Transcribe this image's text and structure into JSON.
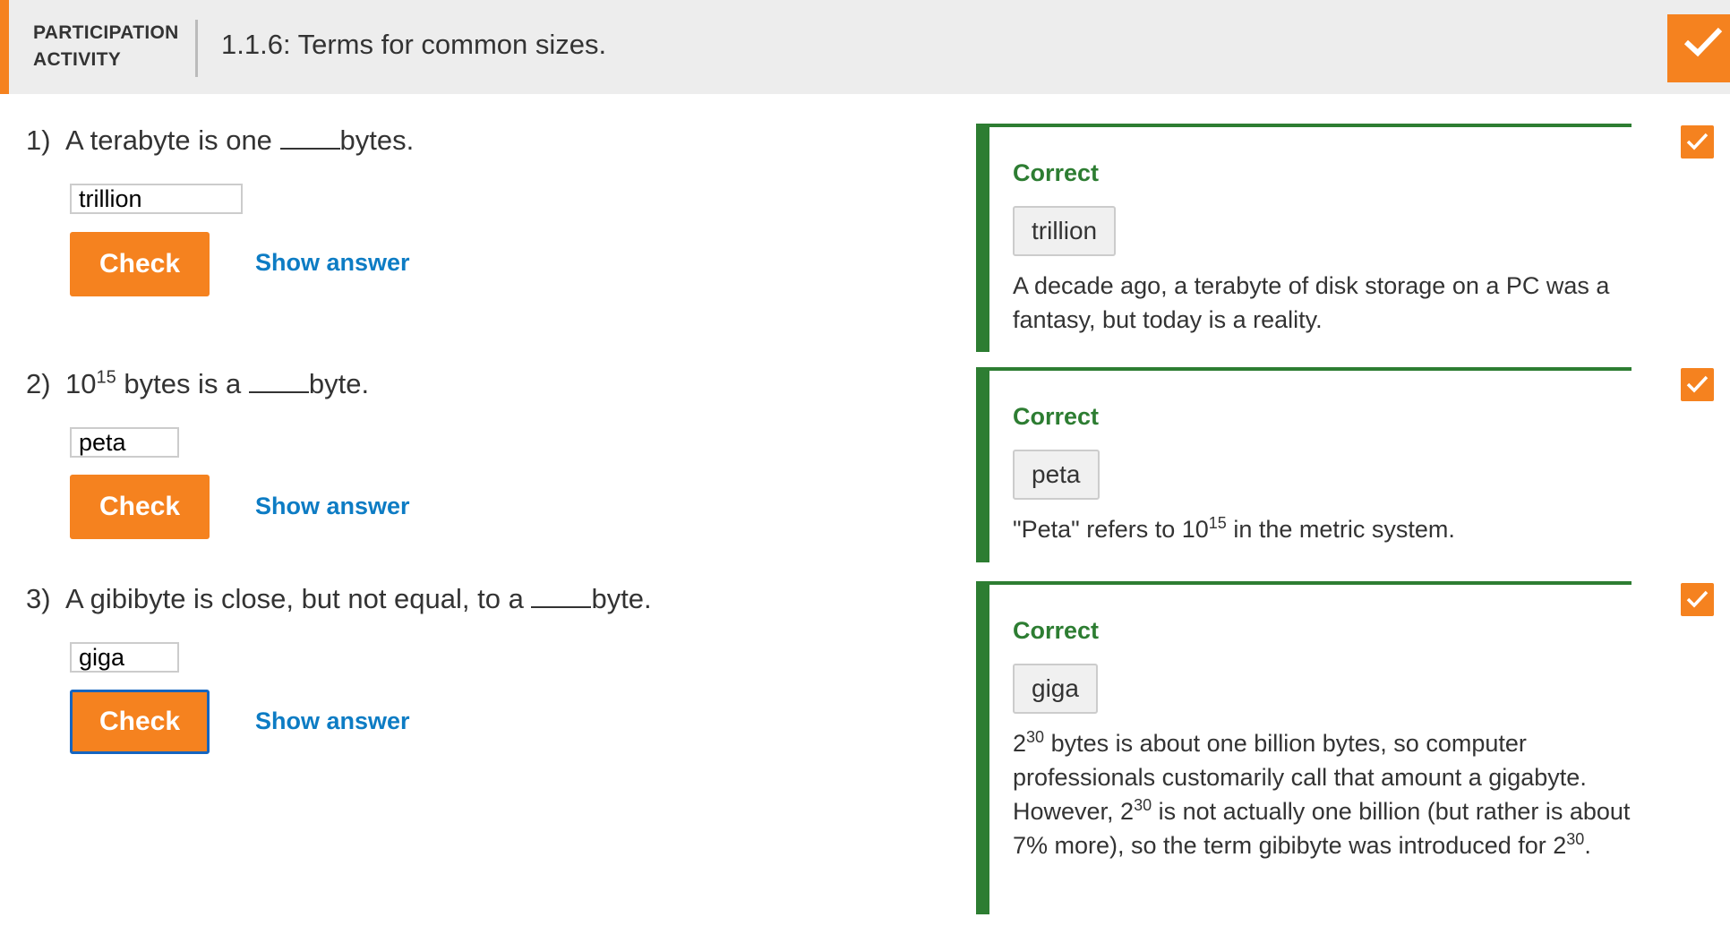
{
  "header": {
    "participation_line1": "PARTICIPATION",
    "participation_line2": "ACTIVITY",
    "activity_title": "1.1.6: Terms for common sizes.",
    "complete_icon": "checkmark-icon"
  },
  "colors": {
    "accent": "#f5821f",
    "correct_green": "#2d7d32",
    "link_blue": "#0d7cc4",
    "focus_blue": "#1565c0"
  },
  "questions": [
    {
      "number": "1)",
      "text_before": "A terabyte is one ",
      "text_after": "bytes.",
      "input_value": "trillion",
      "check_label": "Check",
      "show_answer_label": "Show answer",
      "feedback": {
        "status": "Correct",
        "answer": "trillion",
        "explanation": "A decade ago, a terabyte of disk storage on a PC was a fantasy, but today is a reality."
      }
    },
    {
      "number": "2)",
      "text_base": "10",
      "text_exp": "15",
      "text_mid": " bytes is a ",
      "text_after": "byte.",
      "input_value": "peta",
      "check_label": "Check",
      "show_answer_label": "Show answer",
      "feedback": {
        "status": "Correct",
        "answer": "peta",
        "expl_before": "\"Peta\" refers to 10",
        "expl_exp": "15",
        "expl_after": " in the metric system."
      }
    },
    {
      "number": "3)",
      "text_before": "A gibibyte is close, but not equal, to a ",
      "text_after": "byte.",
      "input_value": "giga",
      "check_label": "Check",
      "show_answer_label": "Show answer",
      "feedback": {
        "status": "Correct",
        "answer": "giga",
        "p1": "2",
        "e1": "30",
        "p2": " bytes is about one billion bytes, so computer professionals customarily call that amount a gigabyte. However, 2",
        "e2": "30",
        "p3": " is not actually one billion (but rather is about 7% more), so the term gibibyte was introduced for 2",
        "e3": "30",
        "p4": "."
      }
    }
  ]
}
